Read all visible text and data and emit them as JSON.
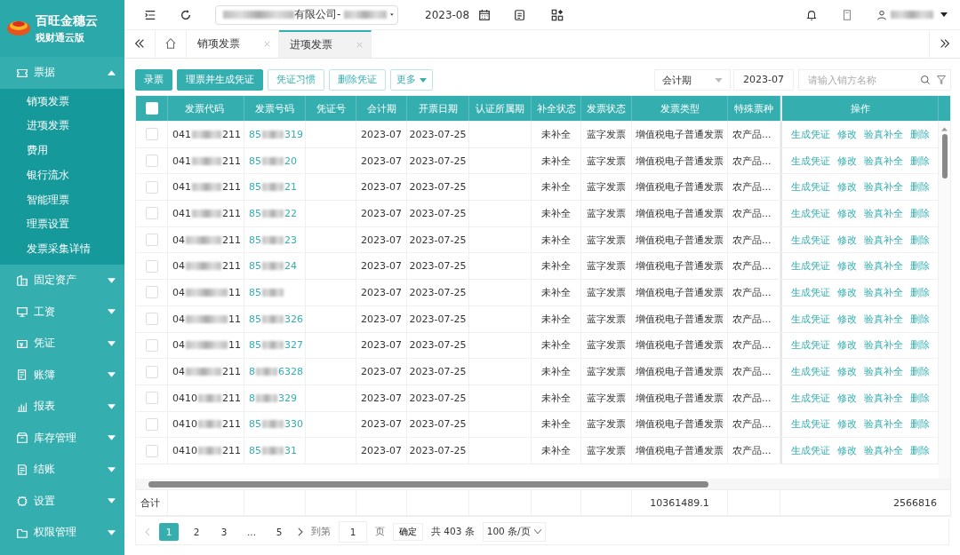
{
  "brand": {
    "name": "百旺金穗云",
    "edition": "税财通云版"
  },
  "topbar": {
    "company": "有限公司-",
    "period": "2023-08"
  },
  "sidebar": {
    "items": [
      {
        "label": "票据",
        "kind": "ticket",
        "expanded": true,
        "children": [
          {
            "label": "销项发票",
            "selected": false
          },
          {
            "label": "进项发票",
            "selected": false
          },
          {
            "label": "费用",
            "selected": false
          },
          {
            "label": "银行流水",
            "selected": false
          },
          {
            "label": "智能理票",
            "selected": false
          },
          {
            "label": "理票设置",
            "selected": false
          },
          {
            "label": "发票采集详情",
            "selected": false
          }
        ]
      },
      {
        "label": "固定资产",
        "kind": "building",
        "expanded": false
      },
      {
        "label": "工资",
        "kind": "monitor",
        "expanded": false
      },
      {
        "label": "凭证",
        "kind": "voucher",
        "expanded": false
      },
      {
        "label": "账簿",
        "kind": "book",
        "expanded": false
      },
      {
        "label": "报表",
        "kind": "chart",
        "expanded": false
      },
      {
        "label": "库存管理",
        "kind": "box",
        "expanded": false
      },
      {
        "label": "结账",
        "kind": "doc",
        "expanded": false
      },
      {
        "label": "设置",
        "kind": "gear",
        "expanded": false
      },
      {
        "label": "权限管理",
        "kind": "folder",
        "expanded": false
      }
    ]
  },
  "tabs": [
    {
      "label": "销项发票",
      "selected": false
    },
    {
      "label": "进项发票",
      "selected": true
    }
  ],
  "toolbar": [
    {
      "label": "录票",
      "kind": "primary"
    },
    {
      "label": "理票并生成凭证",
      "kind": "primary"
    },
    {
      "label": "凭证习惯",
      "kind": "outline"
    },
    {
      "label": "删除凭证",
      "kind": "outline"
    }
  ],
  "more": "更多",
  "filters": {
    "period_type": "会计期",
    "period": "2023-07",
    "search": {
      "placeholder": "请输入销方名称"
    }
  },
  "table": {
    "select_all": false,
    "columns": [
      "发票代码",
      "发票号码",
      "凭证号",
      "会计期",
      "开票日期",
      "认证所属期",
      "补全状态",
      "发票状态",
      "发票类型",
      "特殊票种",
      "操作"
    ],
    "rows": [
      {
        "selected": false,
        "code_head": "041",
        "code_tail": "211",
        "no_head": "85",
        "no_tail": "319",
        "period": "2023-07",
        "date": "2023-07-25",
        "fill": "未补全",
        "status": "蓝字发票",
        "type": "增值税电子普通发票",
        "special": "农产品...",
        "actions": [
          "生成凭证",
          "修改",
          "验真补全",
          "删除"
        ]
      },
      {
        "selected": false,
        "code_head": "041",
        "code_tail": "211",
        "no_head": "85",
        "no_tail": "20",
        "period": "2023-07",
        "date": "2023-07-25",
        "fill": "未补全",
        "status": "蓝字发票",
        "type": "增值税电子普通发票",
        "special": "农产品...",
        "actions": [
          "生成凭证",
          "修改",
          "验真补全",
          "删除"
        ]
      },
      {
        "selected": false,
        "code_head": "041",
        "code_tail": "211",
        "no_head": "85",
        "no_tail": "21",
        "period": "2023-07",
        "date": "2023-07-25",
        "fill": "未补全",
        "status": "蓝字发票",
        "type": "增值税电子普通发票",
        "special": "农产品...",
        "actions": [
          "生成凭证",
          "修改",
          "验真补全",
          "删除"
        ]
      },
      {
        "selected": false,
        "code_head": "041",
        "code_tail": "211",
        "no_head": "85",
        "no_tail": "22",
        "period": "2023-07",
        "date": "2023-07-25",
        "fill": "未补全",
        "status": "蓝字发票",
        "type": "增值税电子普通发票",
        "special": "农产品...",
        "actions": [
          "生成凭证",
          "修改",
          "验真补全",
          "删除"
        ]
      },
      {
        "selected": false,
        "code_head": "04",
        "code_tail": "211",
        "no_head": "85",
        "no_tail": "23",
        "period": "2023-07",
        "date": "2023-07-25",
        "fill": "未补全",
        "status": "蓝字发票",
        "type": "增值税电子普通发票",
        "special": "农产品...",
        "actions": [
          "生成凭证",
          "修改",
          "验真补全",
          "删除"
        ]
      },
      {
        "selected": false,
        "code_head": "04",
        "code_tail": "211",
        "no_head": "85",
        "no_tail": "24",
        "period": "2023-07",
        "date": "2023-07-25",
        "fill": "未补全",
        "status": "蓝字发票",
        "type": "增值税电子普通发票",
        "special": "农产品...",
        "actions": [
          "生成凭证",
          "修改",
          "验真补全",
          "删除"
        ]
      },
      {
        "selected": false,
        "code_head": "04",
        "code_tail": "11",
        "no_head": "85",
        "period": "2023-07",
        "date": "2023-07-25",
        "fill": "未补全",
        "status": "蓝字发票",
        "type": "增值税电子普通发票",
        "special": "农产品...",
        "actions": [
          "生成凭证",
          "修改",
          "验真补全",
          "删除"
        ]
      },
      {
        "selected": false,
        "code_head": "04",
        "code_tail": "11",
        "no_head": "85",
        "no_tail": "326",
        "period": "2023-07",
        "date": "2023-07-25",
        "fill": "未补全",
        "status": "蓝字发票",
        "type": "增值税电子普通发票",
        "special": "农产品...",
        "actions": [
          "生成凭证",
          "修改",
          "验真补全",
          "删除"
        ]
      },
      {
        "selected": false,
        "code_head": "04",
        "code_tail": "11",
        "no_head": "85",
        "no_tail": "327",
        "period": "2023-07",
        "date": "2023-07-25",
        "fill": "未补全",
        "status": "蓝字发票",
        "type": "增值税电子普通发票",
        "special": "农产品...",
        "actions": [
          "生成凭证",
          "修改",
          "验真补全",
          "删除"
        ]
      },
      {
        "selected": false,
        "code_head": "04",
        "code_tail": "211",
        "no_head": "8",
        "no_tail": "6328",
        "period": "2023-07",
        "date": "2023-07-25",
        "fill": "未补全",
        "status": "蓝字发票",
        "type": "增值税电子普通发票",
        "special": "农产品...",
        "actions": [
          "生成凭证",
          "修改",
          "验真补全",
          "删除"
        ]
      },
      {
        "selected": false,
        "code_head": "0410",
        "code_tail": "211",
        "no_head": "8",
        "no_tail": "329",
        "period": "2023-07",
        "date": "2023-07-25",
        "fill": "未补全",
        "status": "蓝字发票",
        "type": "增值税电子普通发票",
        "special": "农产品...",
        "actions": [
          "生成凭证",
          "修改",
          "验真补全",
          "删除"
        ]
      },
      {
        "selected": false,
        "code_head": "0410",
        "code_tail": "211",
        "no_head": "85",
        "no_tail": "330",
        "period": "2023-07",
        "date": "2023-07-25",
        "fill": "未补全",
        "status": "蓝字发票",
        "type": "增值税电子普通发票",
        "special": "农产品...",
        "actions": [
          "生成凭证",
          "修改",
          "验真补全",
          "删除"
        ]
      },
      {
        "selected": false,
        "code_head": "0410",
        "code_tail": "211",
        "no_head": "85",
        "no_tail": "31",
        "period": "2023-07",
        "date": "2023-07-25",
        "fill": "未补全",
        "status": "蓝字发票",
        "type": "增值税电子普通发票",
        "special": "农产品...",
        "actions": [
          "生成凭证",
          "修改",
          "验真补全",
          "删除"
        ]
      }
    ],
    "total": {
      "label": "合计",
      "amount": "10361489.1",
      "tax": "2566816"
    }
  },
  "pagination": {
    "pages": [
      {
        "label": "1",
        "selected": true
      },
      {
        "label": "2",
        "selected": false
      },
      {
        "label": "3",
        "selected": false
      },
      {
        "label": "...",
        "selected": false
      },
      {
        "label": "5",
        "selected": false
      }
    ],
    "goto": "到第",
    "page_value": "1",
    "page_unit": "页",
    "confirm": "确定",
    "count": "共 403 条",
    "size": "100 条/页"
  }
}
